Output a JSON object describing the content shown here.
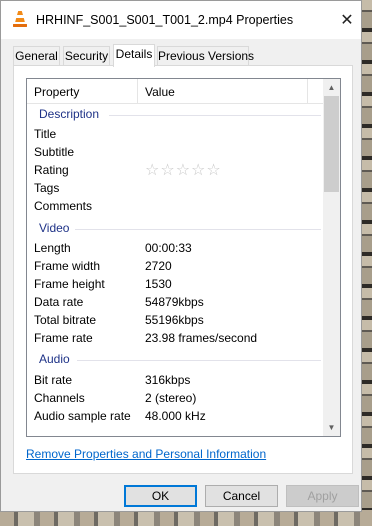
{
  "window": {
    "title": "HRHINF_S001_S001_T001_2.mp4 Properties",
    "close_glyph": "✕",
    "app_icon": "vlc-cone-icon"
  },
  "tabs": [
    {
      "label": "General"
    },
    {
      "label": "Security"
    },
    {
      "label": "Details",
      "active": true
    },
    {
      "label": "Previous Versions"
    }
  ],
  "list": {
    "columns": [
      "Property",
      "Value"
    ],
    "description": {
      "header": "Description",
      "rows": [
        {
          "name": "Title",
          "value": ""
        },
        {
          "name": "Subtitle",
          "value": ""
        },
        {
          "name": "Rating",
          "value": "☆☆☆☆☆"
        },
        {
          "name": "Tags",
          "value": ""
        },
        {
          "name": "Comments",
          "value": ""
        }
      ]
    },
    "video": {
      "header": "Video",
      "rows": [
        {
          "name": "Length",
          "value": "00:00:33"
        },
        {
          "name": "Frame width",
          "value": "2720"
        },
        {
          "name": "Frame height",
          "value": "1530"
        },
        {
          "name": "Data rate",
          "value": "54879kbps"
        },
        {
          "name": "Total bitrate",
          "value": "55196kbps"
        },
        {
          "name": "Frame rate",
          "value": "23.98 frames/second"
        }
      ]
    },
    "audio": {
      "header": "Audio",
      "rows": [
        {
          "name": "Bit rate",
          "value": "316kbps"
        },
        {
          "name": "Channels",
          "value": "2 (stereo)"
        },
        {
          "name": "Audio sample rate",
          "value": "48.000 kHz"
        }
      ]
    },
    "scroll": {
      "up": "▲",
      "down": "▼"
    }
  },
  "remove_link": "Remove Properties and Personal Information",
  "buttons": {
    "ok": "OK",
    "cancel": "Cancel",
    "apply": "Apply"
  },
  "colors": {
    "section_header": "#1e3287",
    "link": "#0066cc",
    "default_button_border": "#0078d7"
  }
}
